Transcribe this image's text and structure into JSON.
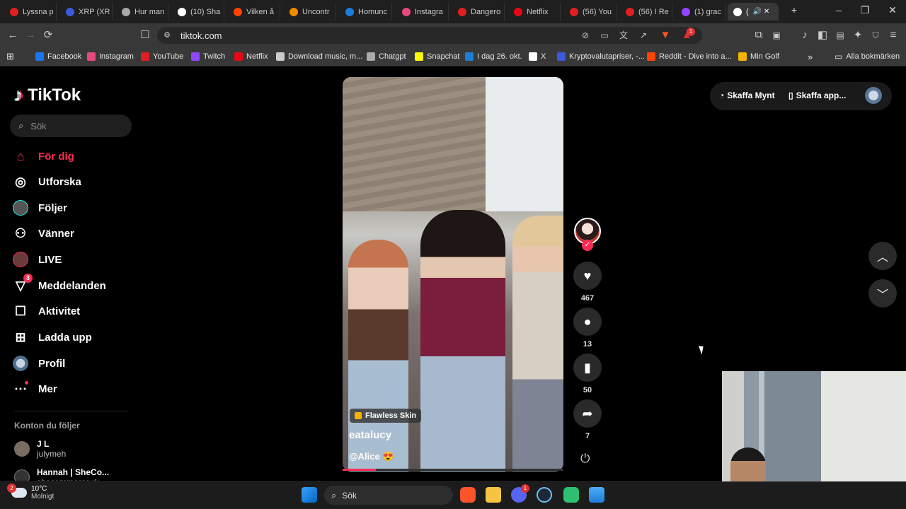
{
  "browser": {
    "tabs": [
      {
        "label": "Lyssna p",
        "color": "#e02020"
      },
      {
        "label": "XRP (XR",
        "color": "#3b5bdb"
      },
      {
        "label": "Hur man",
        "color": "#aaaaaa"
      },
      {
        "label": "(10) Sha",
        "color": "#ffffff"
      },
      {
        "label": "Vilken å",
        "color": "#ff4500"
      },
      {
        "label": "Uncontr",
        "color": "#f08c00"
      },
      {
        "label": "Homunc",
        "color": "#1c7ed6"
      },
      {
        "label": "Instagra",
        "color": "#e64980"
      },
      {
        "label": "Dangero",
        "color": "#e02020"
      },
      {
        "label": "Netflix",
        "color": "#e50914"
      },
      {
        "label": "(56) You",
        "color": "#e02020"
      },
      {
        "label": "(56) I Re",
        "color": "#e02020"
      },
      {
        "label": "(1) grac",
        "color": "#9146ff"
      },
      {
        "label": "(",
        "color": "#ffffff"
      }
    ],
    "url": "tiktok.com",
    "bookmarks": [
      {
        "label": "Facebook",
        "color": "#1877f2"
      },
      {
        "label": "Instagram",
        "color": "#e64980"
      },
      {
        "label": "YouTube",
        "color": "#e02020"
      },
      {
        "label": "Twitch",
        "color": "#9146ff"
      },
      {
        "label": "Netflix",
        "color": "#e50914"
      },
      {
        "label": "Download music, m...",
        "color": "#cccccc"
      },
      {
        "label": "Chatgpt",
        "color": "#aaaaaa"
      },
      {
        "label": "Snapchat",
        "color": "#fffc00"
      },
      {
        "label": "I dag 26. okt.",
        "color": "#1c7ed6"
      },
      {
        "label": "X",
        "color": "#ffffff"
      },
      {
        "label": "Kryptovalutapriser, -...",
        "color": "#3b5bdb"
      },
      {
        "label": "Reddit - Dive into a...",
        "color": "#ff4500"
      },
      {
        "label": "Min Golf",
        "color": "#f5b301"
      }
    ],
    "all_bookmarks": "Alla bokmärken",
    "notif_count": "1"
  },
  "tiktok": {
    "logo": "TikTok",
    "search_placeholder": "Sök",
    "nav": [
      {
        "label": "För dig"
      },
      {
        "label": "Utforska"
      },
      {
        "label": "Följer"
      },
      {
        "label": "Vänner"
      },
      {
        "label": "LIVE"
      },
      {
        "label": "Meddelanden",
        "badge": "3"
      },
      {
        "label": "Aktivitet"
      },
      {
        "label": "Ladda upp"
      },
      {
        "label": "Profil"
      },
      {
        "label": "Mer"
      }
    ],
    "following_header": "Konton du följer",
    "accounts": [
      {
        "name": "J L",
        "handle": "julymeh"
      },
      {
        "name": "Hannah | SheCo...",
        "handle": "shecommerceuk"
      }
    ],
    "video": {
      "tag": "Flawless Skin",
      "author": "eatalucy",
      "mention": "@Alice 😍",
      "progress": 0.15
    },
    "actions": {
      "likes": "467",
      "comments": "13",
      "saves": "50",
      "shares": "7"
    },
    "top_right": {
      "coins": "Skaffa Mynt",
      "app": "Skaffa app..."
    }
  },
  "taskbar": {
    "weather_temp": "10°C",
    "weather_desc": "Molnigt",
    "weather_badge": "2",
    "search_placeholder": "Sök",
    "discord_badge": "1"
  }
}
